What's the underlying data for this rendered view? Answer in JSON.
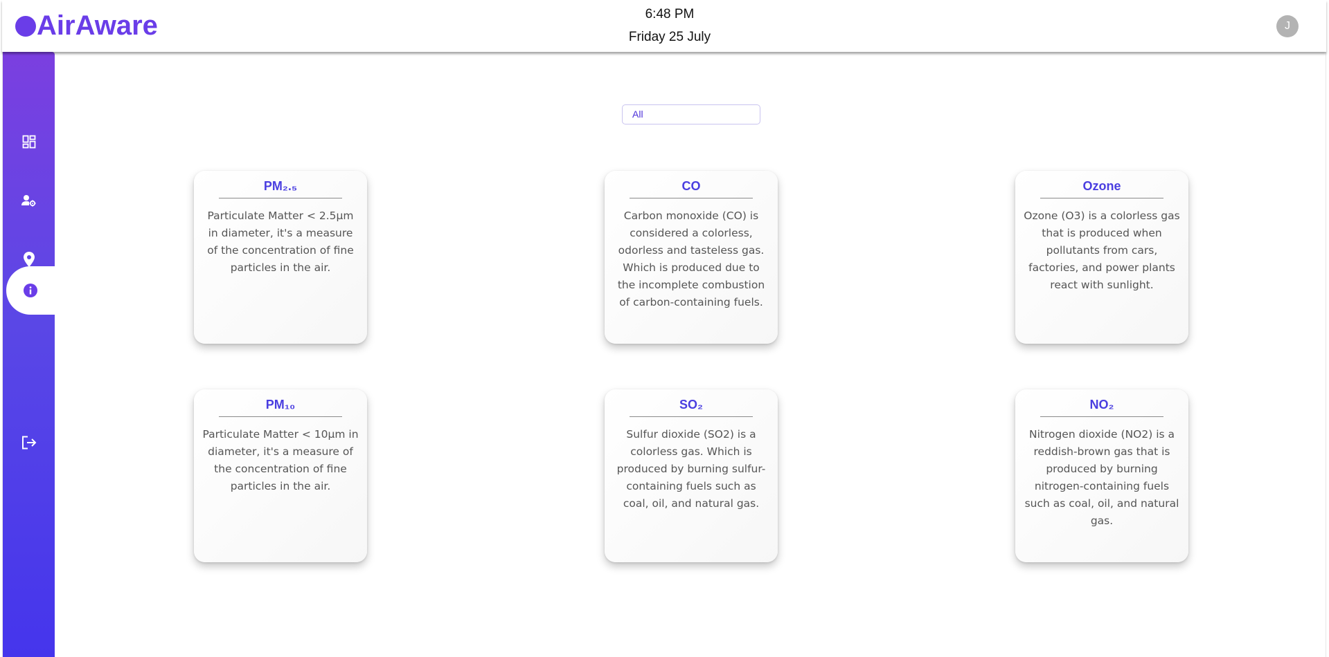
{
  "header": {
    "logo_text": "AirAware",
    "time": "6:48 PM",
    "date": "Friday 25 July",
    "avatar_initial": "J"
  },
  "sidebar": {
    "items": [
      {
        "name": "dashboard",
        "icon": "dashboard-icon",
        "active": false
      },
      {
        "name": "user-settings",
        "icon": "user-settings-icon",
        "active": false
      },
      {
        "name": "location",
        "icon": "location-pin-icon",
        "active": false
      },
      {
        "name": "info",
        "icon": "info-icon",
        "active": true
      },
      {
        "name": "logout",
        "icon": "logout-icon",
        "active": false
      }
    ]
  },
  "filter": {
    "selected": "All"
  },
  "cards": [
    {
      "title": "PM₂.₅",
      "description": "Particulate Matter < 2.5µm in diameter, it's a measure of the concentration of fine particles in the air."
    },
    {
      "title": "CO",
      "description": "Carbon monoxide (CO) is considered a colorless, odorless and tasteless gas. Which is produced due to the incomplete combustion of carbon-containing fuels."
    },
    {
      "title": "Ozone",
      "description": "Ozone (O3) is a colorless gas that is produced when pollutants from cars, factories, and power plants react with sunlight."
    },
    {
      "title": "PM₁₀",
      "description": "Particulate Matter < 10µm in diameter, it's a measure of the concentration of fine particles in the air."
    },
    {
      "title": "SO₂",
      "description": "Sulfur dioxide (SO2) is a colorless gas. Which is produced by burning sulfur-containing fuels such as coal, oil, and natural gas."
    },
    {
      "title": "NO₂",
      "description": "Nitrogen dioxide (NO2) is a reddish-brown gas that is produced by burning nitrogen-containing fuels such as coal, oil, and natural gas."
    }
  ],
  "colors": {
    "brand": "#6a3de8",
    "sidebar_top": "#7b3fe0",
    "sidebar_bottom": "#4535ec",
    "card_title": "#4a3ee0"
  }
}
